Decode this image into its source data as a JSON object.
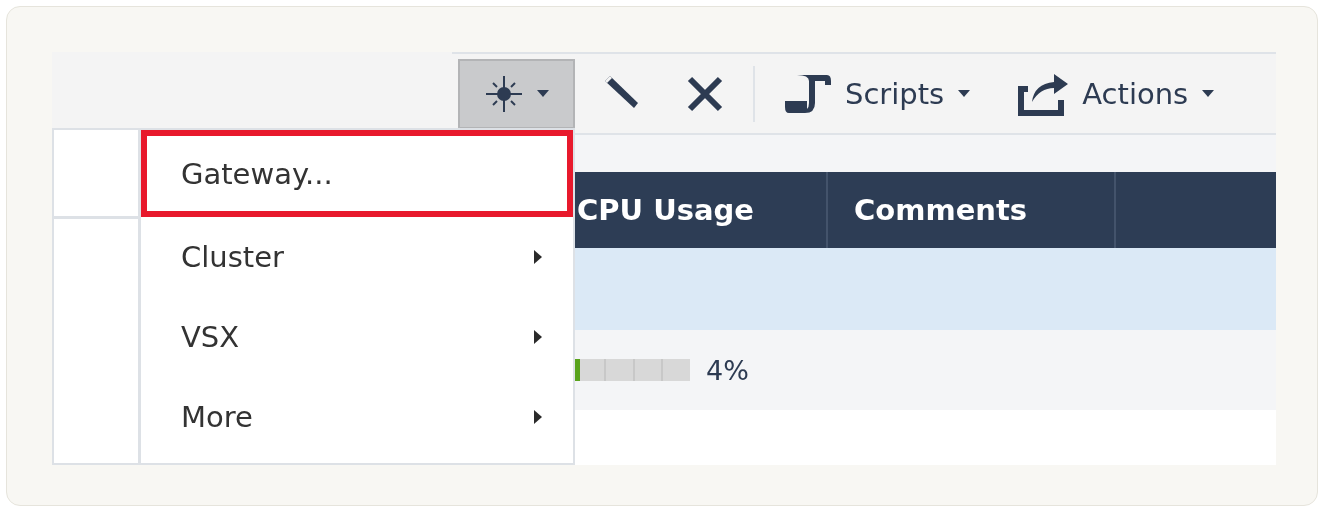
{
  "toolbar": [
    {
      "kind": "new",
      "pressed": true,
      "dropdown": true
    },
    {
      "kind": "edit",
      "pressed": false,
      "dropdown": false
    },
    {
      "kind": "delete",
      "pressed": false,
      "dropdown": false
    },
    {
      "kind": "separator"
    },
    {
      "kind": "scripts",
      "label": "Scripts",
      "pressed": false,
      "dropdown": true
    },
    {
      "kind": "actions",
      "label": "Actions",
      "pressed": false,
      "dropdown": true
    }
  ],
  "table": {
    "columns": [
      "CPU Usage",
      "Comments"
    ],
    "rows": [
      {
        "selected": true
      },
      {
        "selected": false,
        "cpu": {
          "level": 0.04,
          "reading": "4%"
        }
      },
      {
        "selected": false
      }
    ]
  },
  "menu": {
    "items": [
      {
        "label": "Gateway...",
        "selected": true,
        "submenu": false
      },
      {
        "label": "Cluster",
        "selected": false,
        "submenu": true
      },
      {
        "label": "VSX",
        "selected": false,
        "submenu": true
      },
      {
        "label": "More",
        "selected": false,
        "submenu": true
      }
    ]
  }
}
